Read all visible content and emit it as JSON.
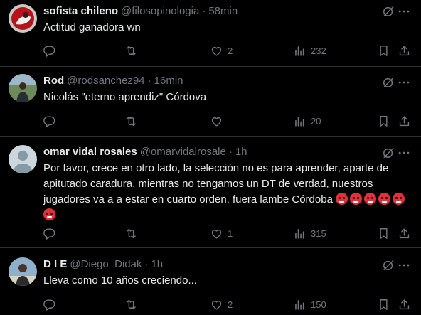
{
  "replies": [
    {
      "name": "sofista chileno",
      "handle": "@filosopinologia",
      "time": "58min",
      "text": "Actitud ganadora wn",
      "likes": "2",
      "views": "232"
    },
    {
      "name": "Rod",
      "handle": "@rodsanchez94",
      "time": "16min",
      "text": "Nicolás \"eterno aprendiz\" Córdova",
      "likes": "",
      "views": "20"
    },
    {
      "name": "omar vidal rosales",
      "handle": "@omarvidalrosale",
      "time": "1h",
      "text": "Por favor, crece en otro lado, la selección no es para aprender, aparte de apitutado caradura, mientras no tengamos un DT de verdad, nuestros jugadores va a a estar en cuarto orden, fuera lambe Córdoba",
      "emoji_count": 6,
      "likes": "1",
      "views": "315"
    },
    {
      "name": "D I E",
      "handle": "@Diego_Didak",
      "time": "1h",
      "text": "Lleva como 10 años creciendo...",
      "likes": "2",
      "views": "150"
    }
  ],
  "separator": "·",
  "colors": {
    "background": "#000000",
    "text": "#e7e9ea",
    "muted": "#71767b",
    "border": "#2f3336",
    "emoji": "#e0303a"
  },
  "icons": [
    "reply-icon",
    "retweet-icon",
    "like-icon",
    "views-icon",
    "bookmark-icon",
    "share-icon",
    "grok-icon",
    "more-icon"
  ]
}
